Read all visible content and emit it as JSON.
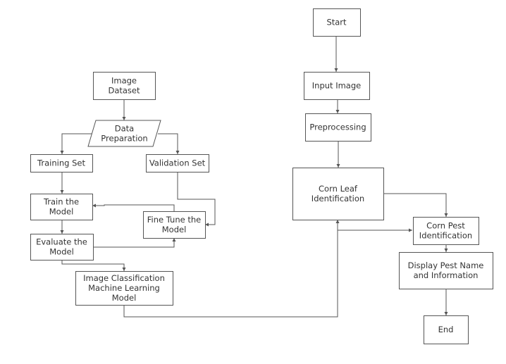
{
  "nodes": {
    "image_dataset": [
      "Image",
      "Dataset"
    ],
    "data_preparation": [
      "Data",
      "Preparation"
    ],
    "training_set": [
      "Training Set"
    ],
    "validation_set": [
      "Validation Set"
    ],
    "train_model": [
      "Train the",
      "Model"
    ],
    "fine_tune": [
      "Fine Tune the",
      "Model"
    ],
    "evaluate_model": [
      "Evaluate the",
      "Model"
    ],
    "image_classification": [
      "Image Classification",
      "Machine Learning",
      "Model"
    ],
    "start": [
      "Start"
    ],
    "input_image": [
      "Input Image"
    ],
    "preprocessing": [
      "Preprocessing"
    ],
    "corn_leaf": [
      "Corn Leaf",
      "Identification"
    ],
    "corn_pest": [
      "Corn Pest",
      "Identification"
    ],
    "display_pest": [
      "Display Pest Name",
      "and Information"
    ],
    "end": [
      "End"
    ]
  },
  "colors": {
    "line": "#555555",
    "text": "#333333",
    "background": "#ffffff"
  }
}
